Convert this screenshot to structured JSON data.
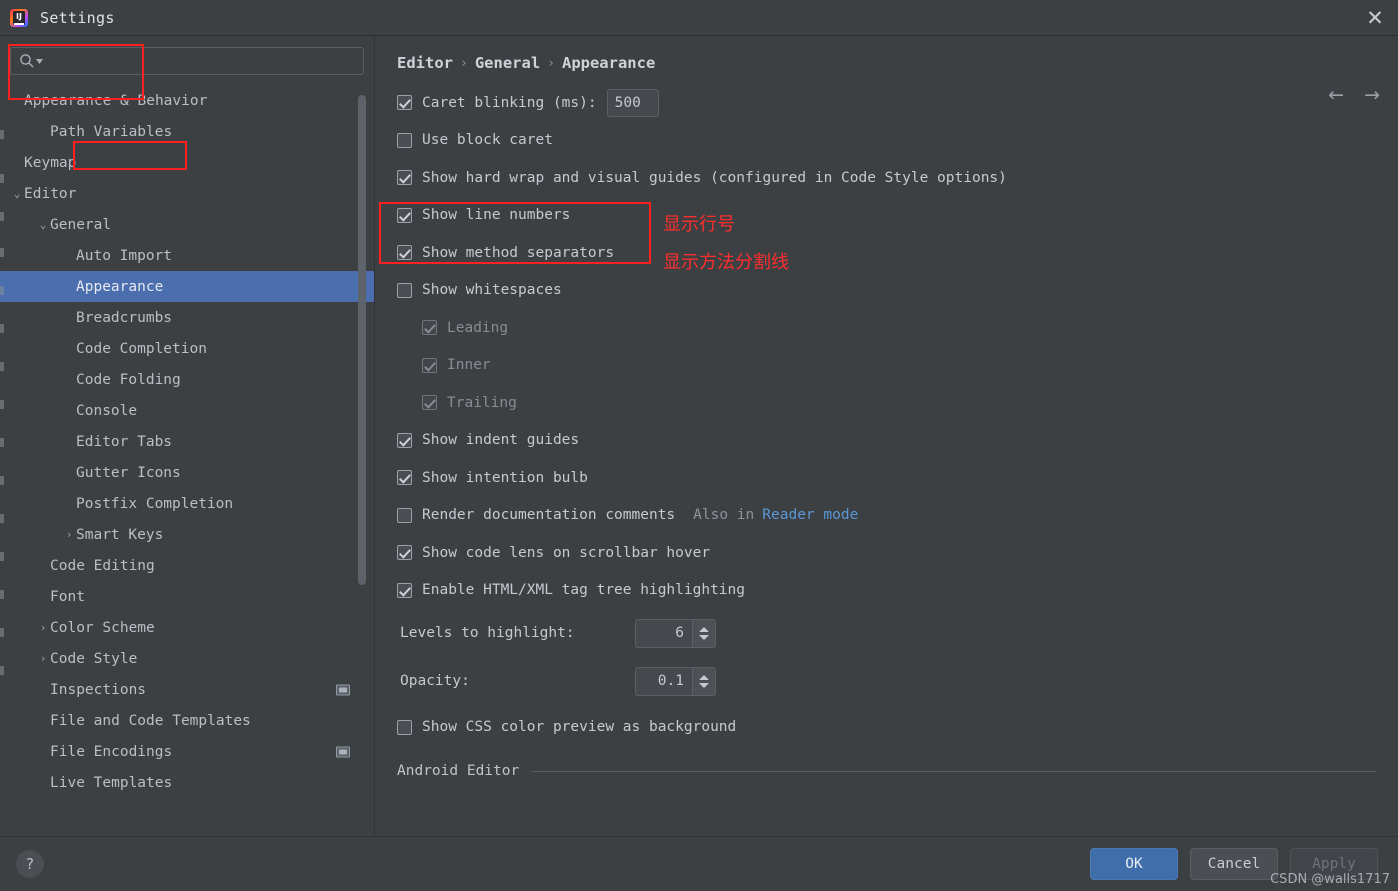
{
  "window": {
    "title": "Settings",
    "logo_text": "IJ",
    "close_label": "✕"
  },
  "search": {
    "value": "",
    "placeholder": "",
    "icon": "search-icon"
  },
  "sidebar": {
    "scroll_position": "middle",
    "items": [
      {
        "label": "Appearance & Behavior",
        "indent": 0,
        "twisty": "",
        "selected": false,
        "trailing_icon": false
      },
      {
        "label": "Path Variables",
        "indent": 1,
        "twisty": "",
        "selected": false,
        "trailing_icon": false
      },
      {
        "label": "Keymap",
        "indent": 0,
        "twisty": "",
        "selected": false,
        "trailing_icon": false
      },
      {
        "label": "Editor",
        "indent": 0,
        "twisty": "⌄",
        "selected": false,
        "trailing_icon": false
      },
      {
        "label": "General",
        "indent": 1,
        "twisty": "⌄",
        "selected": false,
        "trailing_icon": false
      },
      {
        "label": "Auto Import",
        "indent": 2,
        "twisty": "",
        "selected": false,
        "trailing_icon": false
      },
      {
        "label": "Appearance",
        "indent": 2,
        "twisty": "",
        "selected": true,
        "trailing_icon": false
      },
      {
        "label": "Breadcrumbs",
        "indent": 2,
        "twisty": "",
        "selected": false,
        "trailing_icon": false
      },
      {
        "label": "Code Completion",
        "indent": 2,
        "twisty": "",
        "selected": false,
        "trailing_icon": false
      },
      {
        "label": "Code Folding",
        "indent": 2,
        "twisty": "",
        "selected": false,
        "trailing_icon": false
      },
      {
        "label": "Console",
        "indent": 2,
        "twisty": "",
        "selected": false,
        "trailing_icon": false
      },
      {
        "label": "Editor Tabs",
        "indent": 2,
        "twisty": "",
        "selected": false,
        "trailing_icon": false
      },
      {
        "label": "Gutter Icons",
        "indent": 2,
        "twisty": "",
        "selected": false,
        "trailing_icon": false
      },
      {
        "label": "Postfix Completion",
        "indent": 2,
        "twisty": "",
        "selected": false,
        "trailing_icon": false
      },
      {
        "label": "Smart Keys",
        "indent": 2,
        "twisty": "›",
        "selected": false,
        "trailing_icon": false
      },
      {
        "label": "Code Editing",
        "indent": 1,
        "twisty": "",
        "selected": false,
        "trailing_icon": false
      },
      {
        "label": "Font",
        "indent": 1,
        "twisty": "",
        "selected": false,
        "trailing_icon": false
      },
      {
        "label": "Color Scheme",
        "indent": 1,
        "twisty": "›",
        "selected": false,
        "trailing_icon": false
      },
      {
        "label": "Code Style",
        "indent": 1,
        "twisty": "›",
        "selected": false,
        "trailing_icon": false
      },
      {
        "label": "Inspections",
        "indent": 1,
        "twisty": "",
        "selected": false,
        "trailing_icon": true
      },
      {
        "label": "File and Code Templates",
        "indent": 1,
        "twisty": "",
        "selected": false,
        "trailing_icon": false
      },
      {
        "label": "File Encodings",
        "indent": 1,
        "twisty": "",
        "selected": false,
        "trailing_icon": true
      },
      {
        "label": "Live Templates",
        "indent": 1,
        "twisty": "",
        "selected": false,
        "trailing_icon": false
      }
    ]
  },
  "breadcrumb": {
    "parts": [
      "Editor",
      "General",
      "Appearance"
    ],
    "separator": "›"
  },
  "nav": {
    "back": "←",
    "forward": "→"
  },
  "options": [
    {
      "id": "caret-blinking",
      "label": "Caret blinking (ms):",
      "checked": true,
      "enabled": true,
      "indent": 0,
      "field": "500"
    },
    {
      "id": "use-block-caret",
      "label": "Use block caret",
      "checked": false,
      "enabled": true,
      "indent": 0
    },
    {
      "id": "show-hard-wrap",
      "label": "Show hard wrap and visual guides (configured in Code Style options)",
      "checked": true,
      "enabled": true,
      "indent": 0
    },
    {
      "id": "show-line-numbers",
      "label": "Show line numbers",
      "checked": true,
      "enabled": true,
      "indent": 0
    },
    {
      "id": "show-method-separators",
      "label": "Show method separators",
      "checked": true,
      "enabled": true,
      "indent": 0
    },
    {
      "id": "show-whitespaces",
      "label": "Show whitespaces",
      "checked": false,
      "enabled": true,
      "indent": 0
    },
    {
      "id": "leading",
      "label": "Leading",
      "checked": true,
      "enabled": false,
      "indent": 1
    },
    {
      "id": "inner",
      "label": "Inner",
      "checked": true,
      "enabled": false,
      "indent": 1
    },
    {
      "id": "trailing",
      "label": "Trailing",
      "checked": true,
      "enabled": false,
      "indent": 1
    },
    {
      "id": "show-indent-guides",
      "label": "Show indent guides",
      "checked": true,
      "enabled": true,
      "indent": 0
    },
    {
      "id": "show-intention-bulb",
      "label": "Show intention bulb",
      "checked": true,
      "enabled": true,
      "indent": 0
    },
    {
      "id": "render-doc-comments",
      "label": "Render documentation comments",
      "checked": false,
      "enabled": true,
      "indent": 0,
      "note": "Also in",
      "link": "Reader mode"
    },
    {
      "id": "show-code-lens",
      "label": "Show code lens on scrollbar hover",
      "checked": true,
      "enabled": true,
      "indent": 0
    },
    {
      "id": "enable-tag-tree",
      "label": "Enable HTML/XML tag tree highlighting",
      "checked": true,
      "enabled": true,
      "indent": 0
    }
  ],
  "spinners": [
    {
      "id": "levels-to-highlight",
      "label": "Levels to highlight:",
      "value": "6"
    },
    {
      "id": "opacity",
      "label": "Opacity:",
      "value": "0.1"
    }
  ],
  "css_preview": {
    "label": "Show CSS color preview as background",
    "checked": false
  },
  "section": {
    "title": "Android Editor"
  },
  "annotations": [
    {
      "id": "note-line-numbers",
      "text": "显示行号"
    },
    {
      "id": "note-method-separators",
      "text": "显示方法分割线"
    }
  ],
  "footer": {
    "help": "?",
    "ok": "OK",
    "cancel": "Cancel",
    "apply": "Apply"
  },
  "watermark": "CSDN @walls1717",
  "colors": {
    "selection": "#4b6eaf",
    "accent_button": "#3f6eab",
    "link": "#5b97d6",
    "annotation": "#ff2d2d",
    "background": "#3c4043"
  }
}
